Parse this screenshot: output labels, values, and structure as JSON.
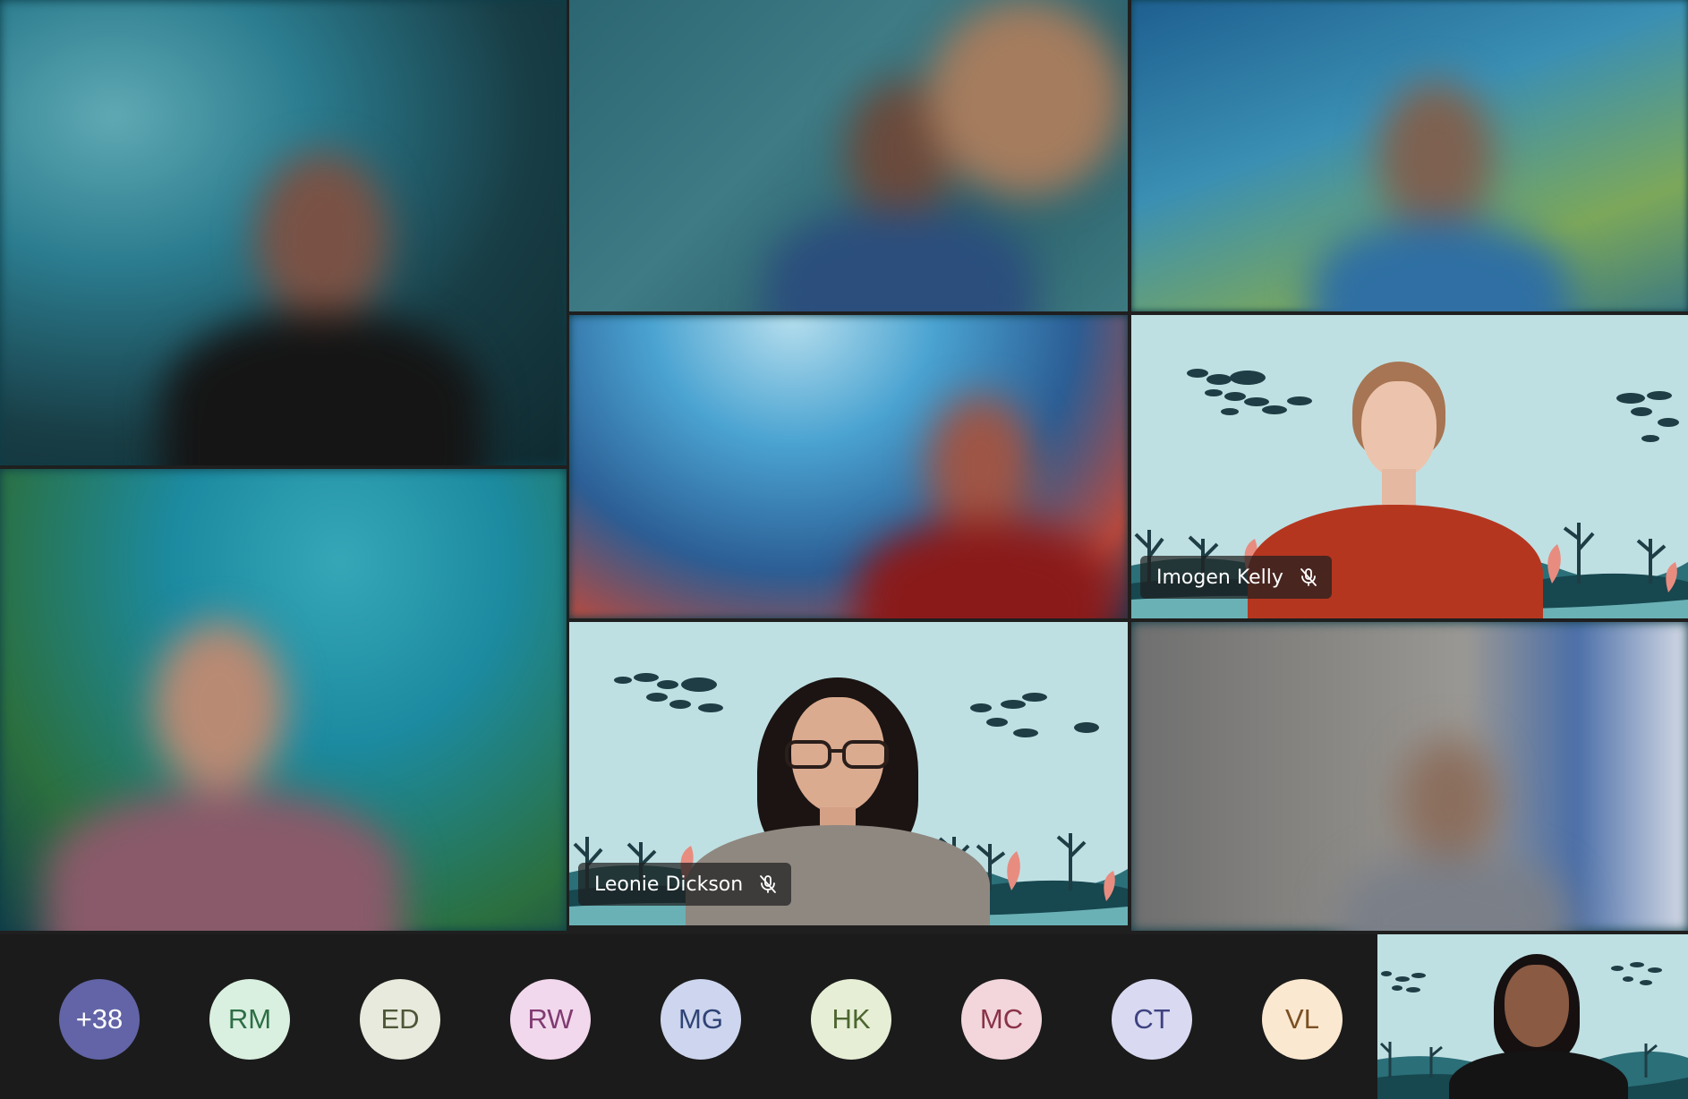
{
  "tiles": {
    "imogen": {
      "name": "Imogen Kelly"
    },
    "leonie": {
      "name": "Leonie Dickson"
    }
  },
  "roster": {
    "overflow": "+38",
    "avatars": [
      {
        "initials": "RM",
        "bg": "#d9f0e0",
        "fg": "#2e6e45"
      },
      {
        "initials": "ED",
        "bg": "#e7eadc",
        "fg": "#4d5637"
      },
      {
        "initials": "RW",
        "bg": "#f2d8ec",
        "fg": "#803b72"
      },
      {
        "initials": "MG",
        "bg": "#cdd6ee",
        "fg": "#2f4376"
      },
      {
        "initials": "HK",
        "bg": "#e6efd6",
        "fg": "#4d6630"
      },
      {
        "initials": "MC",
        "bg": "#f2d6dc",
        "fg": "#8a3246"
      },
      {
        "initials": "CT",
        "bg": "#d9daf2",
        "fg": "#3e4280"
      },
      {
        "initials": "VL",
        "bg": "#fbe8d0",
        "fg": "#7b5022"
      }
    ],
    "overflow_bg": "#6264a7"
  },
  "icons": {
    "muted": "mic-off-icon"
  },
  "colors": {
    "bar_bg": "#1b1b1b",
    "ocean_bg": "#bfe0e3"
  }
}
